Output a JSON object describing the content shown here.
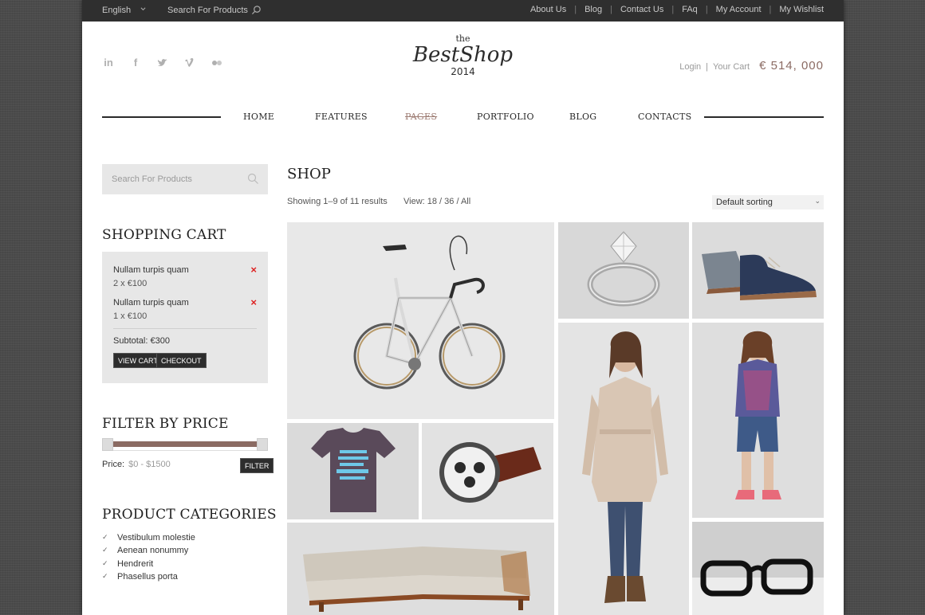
{
  "topbar": {
    "language": "English",
    "search_placeholder": "Search For Products",
    "links": [
      "About Us",
      "Blog",
      "Contact Us",
      "FAq",
      "My Account",
      "My Wishlist"
    ]
  },
  "socials": [
    "linkedin-icon",
    "facebook-icon",
    "twitter-icon",
    "vimeo-icon",
    "flickr-icon"
  ],
  "logo": {
    "the": "the",
    "name": "BestShop",
    "year": "2014"
  },
  "account": {
    "login": "Login",
    "sep": "|",
    "cart": "Your Cart",
    "total": "€ 514, 000"
  },
  "nav": {
    "items": [
      "HOME",
      "FEATURES",
      "PAGES",
      "PORTFOLIO",
      "BLOG",
      "CONTACTS"
    ],
    "active": "PAGES"
  },
  "sidebar": {
    "search_placeholder": "Search For Products",
    "cart_title": "SHOPPING CART",
    "cart_items": [
      {
        "name": "Nullam turpis quam",
        "qty": "2 x €100"
      },
      {
        "name": "Nullam turpis quam",
        "qty": "1 x €100"
      }
    ],
    "remove_symbol": "×",
    "subtotal": "Subtotal: €300",
    "view_cart": "VIEW CART",
    "checkout": "CHECKOUT",
    "filter_title": "FILTER BY PRICE",
    "price_label": "Price:",
    "price_value": "$0 - $1500",
    "filter_button": "FILTER",
    "categories_title": "PRODUCT CATEGORIES",
    "categories": [
      "Vestibulum molestie",
      "Aenean nonummy",
      "Hendrerit",
      "Phasellus porta"
    ]
  },
  "shop": {
    "title": "SHOP",
    "showing": "Showing 1–9 of 11 results",
    "view": "View: 18 / 36 / All",
    "sorting": "Default sorting",
    "products": [
      "bicycle",
      "diamond ring",
      "suede shoes",
      "graphic t-shirt",
      "wristwatch",
      "trench coat",
      "girl outfit",
      "corner sofa",
      "eyeglasses"
    ]
  },
  "colors": {
    "accent": "#8b6b63",
    "topbar": "#2f2f2f",
    "remove": "#dd2222"
  }
}
